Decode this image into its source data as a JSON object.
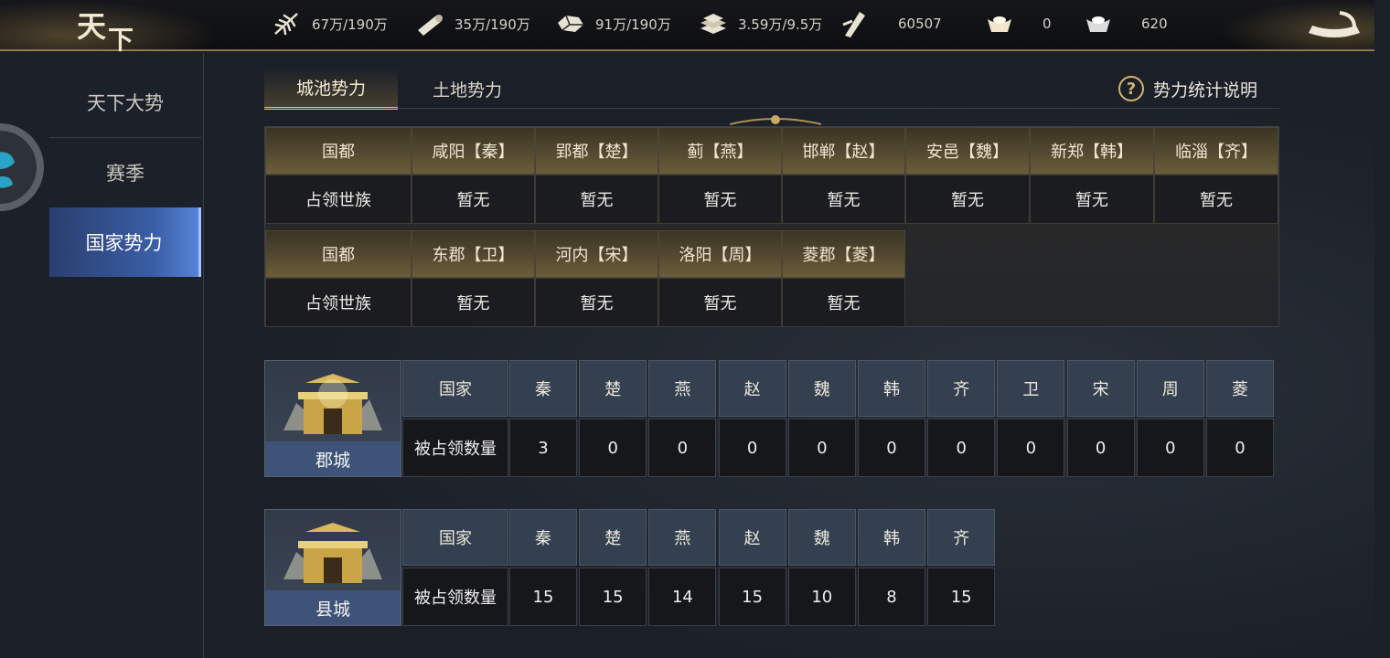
{
  "header": {
    "logo_text": [
      "天",
      "下"
    ],
    "resources": [
      {
        "icon": "wheat-icon",
        "value": "67万/190万"
      },
      {
        "icon": "wood-icon",
        "value": "35万/190万"
      },
      {
        "icon": "stone-icon",
        "value": "91万/190万"
      },
      {
        "icon": "iron-icon",
        "value": "3.59万/9.5万"
      },
      {
        "icon": "order-token-icon",
        "value": "60507"
      },
      {
        "icon": "gold-ingot-icon",
        "value": "0"
      },
      {
        "icon": "silver-ingot-icon",
        "value": "620"
      }
    ]
  },
  "sidebar": {
    "items": [
      {
        "label": "天下大势",
        "active": false
      },
      {
        "label": "赛季",
        "active": false
      },
      {
        "label": "国家势力",
        "active": true
      }
    ]
  },
  "tabs": [
    {
      "label": "城池势力",
      "active": true
    },
    {
      "label": "土地势力",
      "active": false
    }
  ],
  "help_label": "势力统计说明",
  "capitals": {
    "row_head_capital": "国都",
    "row_head_owner": "占领世族",
    "row1": [
      {
        "city": "咸阳【秦】",
        "owner": "暂无"
      },
      {
        "city": "郢都【楚】",
        "owner": "暂无"
      },
      {
        "city": "蓟【燕】",
        "owner": "暂无"
      },
      {
        "city": "邯郸【赵】",
        "owner": "暂无"
      },
      {
        "city": "安邑【魏】",
        "owner": "暂无"
      },
      {
        "city": "新郑【韩】",
        "owner": "暂无"
      },
      {
        "city": "临淄【齐】",
        "owner": "暂无"
      }
    ],
    "row2": [
      {
        "city": "东郡【卫】",
        "owner": "暂无"
      },
      {
        "city": "河内【宋】",
        "owner": "暂无"
      },
      {
        "city": "洛阳【周】",
        "owner": "暂无"
      },
      {
        "city": "菱郡【菱】",
        "owner": "暂无"
      }
    ]
  },
  "commandery": {
    "title": "郡城",
    "head_country": "国家",
    "head_count": "被占领数量",
    "countries": [
      "秦",
      "楚",
      "燕",
      "赵",
      "魏",
      "韩",
      "齐",
      "卫",
      "宋",
      "周",
      "菱"
    ],
    "counts": [
      "3",
      "0",
      "0",
      "0",
      "0",
      "0",
      "0",
      "0",
      "0",
      "0",
      "0"
    ]
  },
  "county": {
    "title": "县城",
    "head_country": "国家",
    "head_count": "被占领数量",
    "countries": [
      "秦",
      "楚",
      "燕",
      "赵",
      "魏",
      "韩",
      "齐"
    ],
    "counts": [
      "15",
      "15",
      "14",
      "15",
      "10",
      "8",
      "15"
    ]
  },
  "colors": {
    "accent_gold": "#d2b46e",
    "active_blue": "#3a5ea6"
  }
}
